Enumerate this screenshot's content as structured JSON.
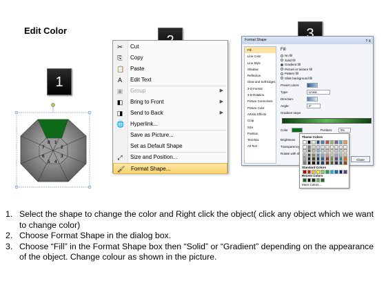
{
  "title": "Edit Color",
  "badges": [
    "1",
    "2",
    "3"
  ],
  "octagon": {
    "segments": [
      "1",
      "2",
      "3",
      "4",
      "5",
      "6",
      "7",
      "8"
    ],
    "highlight_color": "#0f6a17",
    "body_color": "#8a8a8a"
  },
  "context_menu": {
    "items": [
      {
        "label": "Cut",
        "icon": "scissors-icon",
        "glyph": "✂"
      },
      {
        "label": "Copy",
        "icon": "copy-icon",
        "glyph": "⎘"
      },
      {
        "label": "Paste",
        "icon": "paste-icon",
        "glyph": "📋"
      },
      {
        "label": "Edit Text",
        "icon": "edit-text-icon",
        "glyph": "A"
      },
      {
        "label": "Group",
        "icon": "group-icon",
        "glyph": "▣",
        "disabled": true,
        "submenu": true
      },
      {
        "label": "Bring to Front",
        "icon": "bring-front-icon",
        "glyph": "◧",
        "submenu": true
      },
      {
        "label": "Send to Back",
        "icon": "send-back-icon",
        "glyph": "◨",
        "submenu": true
      },
      {
        "label": "Hyperlink...",
        "icon": "globe-icon",
        "glyph": "🌐"
      },
      {
        "label": "Save as Picture...",
        "icon": "",
        "glyph": ""
      },
      {
        "label": "Set as Default Shape",
        "icon": "",
        "glyph": ""
      },
      {
        "label": "Size and Position...",
        "icon": "size-icon",
        "glyph": "⤢"
      },
      {
        "label": "Format Shape...",
        "icon": "format-shape-icon",
        "glyph": "🖌",
        "highlighted": true
      }
    ]
  },
  "dialog": {
    "title": "Format Shape",
    "controls": "? X",
    "categories": [
      "Fill",
      "Line Color",
      "Line Style",
      "Shadow",
      "Reflection",
      "Glow and Soft Edges",
      "3-D Format",
      "3-D Rotation",
      "Picture Corrections",
      "Picture Color",
      "Artistic Effects",
      "Crop",
      "Size",
      "Position",
      "Text Box",
      "Alt Text"
    ],
    "selected_category": "Fill",
    "pane_heading": "Fill",
    "fill_options": [
      "No fill",
      "Solid fill",
      "Gradient fill",
      "Picture or texture fill",
      "Pattern fill",
      "Slide background fill"
    ],
    "selected_fill": "Gradient fill",
    "preset_colors_label": "Preset colors:",
    "type_label": "Type:",
    "type_value": "Linear",
    "direction_label": "Direction:",
    "angle_label": "Angle:",
    "angle_value": "0°",
    "gradient_stops_label": "Gradient stops",
    "color_label": "Color",
    "position_label": "Position:",
    "position_value": "0%",
    "brightness_label": "Brightness",
    "transparency_label": "Transparency",
    "rotate_label": "Rotate with shape",
    "close_label": "Close"
  },
  "palette": {
    "theme_header": "Theme Colors",
    "standard_header": "Standard Colors",
    "recent_header": "Recent Colors",
    "more_label": "More Colors...",
    "theme_top": [
      "#ffffff",
      "#000000",
      "#eeece1",
      "#1f497d",
      "#4f81bd",
      "#c0504d",
      "#9bbb59",
      "#8064a2",
      "#4bacc6",
      "#f79646"
    ],
    "theme_shades": [
      [
        "#f2f2f2",
        "#7f7f7f",
        "#ddd9c3",
        "#c6d9f0",
        "#dbe5f1",
        "#f2dcdb",
        "#ebf1dd",
        "#e5e0ec",
        "#dbeef3",
        "#fdeada"
      ],
      [
        "#d8d8d8",
        "#595959",
        "#c4bd97",
        "#8db3e2",
        "#b8cce4",
        "#e5b9b7",
        "#d7e3bc",
        "#ccc1d9",
        "#b7dde8",
        "#fbd5b5"
      ],
      [
        "#bfbfbf",
        "#3f3f3f",
        "#938953",
        "#548dd4",
        "#95b3d7",
        "#d99694",
        "#c3d69b",
        "#b2a2c7",
        "#92cddc",
        "#fac08f"
      ],
      [
        "#a5a5a5",
        "#262626",
        "#494429",
        "#17365d",
        "#366092",
        "#953734",
        "#76923c",
        "#5f497a",
        "#31859b",
        "#e36c09"
      ],
      [
        "#7f7f7f",
        "#0c0c0c",
        "#1d1b10",
        "#0f243e",
        "#244061",
        "#632423",
        "#4f6128",
        "#3f3151",
        "#205867",
        "#974806"
      ]
    ],
    "standard": [
      "#c00000",
      "#ff0000",
      "#ffc000",
      "#ffff00",
      "#92d050",
      "#00b050",
      "#00b0f0",
      "#0070c0",
      "#002060",
      "#7030a0"
    ],
    "recent": [
      "#0f6a17",
      "#000000",
      "#0f4010",
      "#63b65b",
      "#1f6b1f"
    ]
  },
  "steps": [
    {
      "num": "1.",
      "text": "Select the shape to change the color and Right click the object( click any object which we want to change color)"
    },
    {
      "num": "2.",
      "text": "Choose Format Shape in the dialog box."
    },
    {
      "num": "3.",
      "text": "Choose “Fill” in the Format Shape box then “Solid” or “Gradient” depending on the appearance of the object. Change colour as shown in the picture."
    }
  ]
}
